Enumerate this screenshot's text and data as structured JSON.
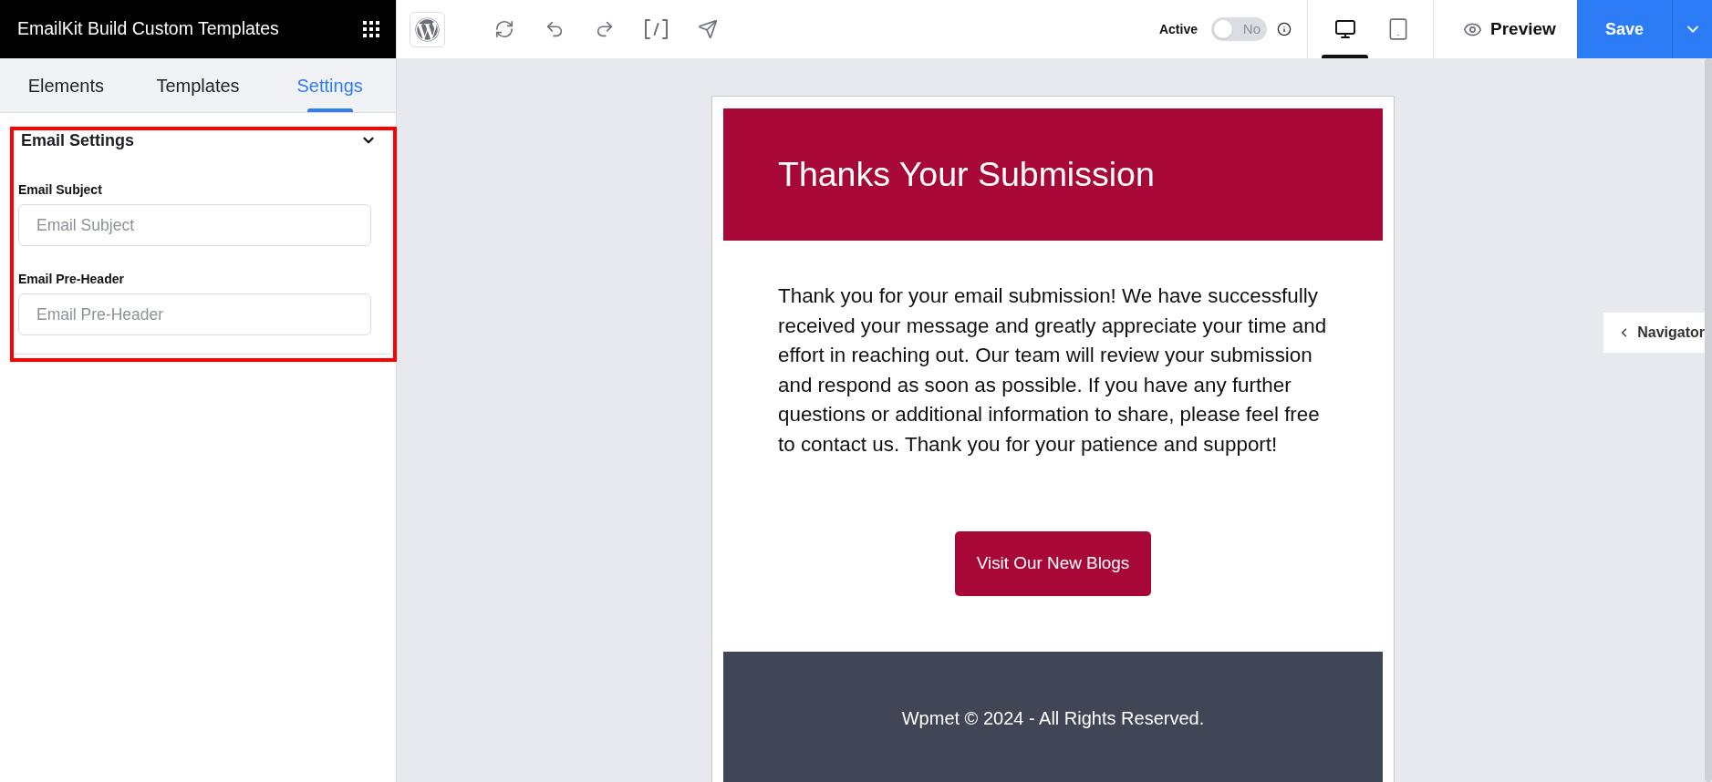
{
  "sidebar": {
    "title": "EmailKit Build Custom Templates",
    "tabs": [
      {
        "label": "Elements",
        "selected": false
      },
      {
        "label": "Templates",
        "selected": false
      },
      {
        "label": "Settings",
        "selected": true
      }
    ],
    "section": {
      "title": "Email Settings",
      "expanded": true,
      "highlighted": true,
      "fields": [
        {
          "label": "Email Subject",
          "placeholder": "Email Subject"
        },
        {
          "label": "Email Pre-Header",
          "placeholder": "Email Pre-Header"
        }
      ]
    }
  },
  "toolbar": {
    "active": {
      "label": "Active",
      "on": false,
      "state_text": "No"
    },
    "devices": [
      {
        "kind": "desktop",
        "selected": true
      },
      {
        "kind": "tablet",
        "selected": false
      }
    ],
    "preview": "Preview",
    "save": "Save"
  },
  "email": {
    "heading": "Thanks Your Submission",
    "body": "Thank you for your email submission! We have successfully received your message and greatly appreciate your time and effort in reaching out. Our team will review your submission and respond as soon as possible. If you have any further questions or additional information to share, please feel free to contact us. Thank you for your patience and support!",
    "button": "Visit Our New Blogs",
    "footer": "Wpmet © 2024 - All Rights Reserved."
  },
  "navigator": {
    "label": "Navigator"
  }
}
